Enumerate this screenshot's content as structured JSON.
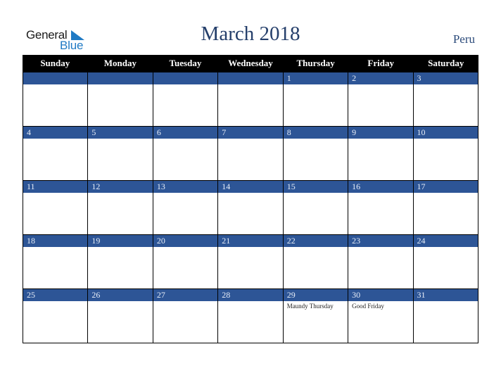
{
  "logo": {
    "line1": "General",
    "line2": "Blue",
    "icon": "triangle-flag-icon",
    "accent": "#1f7ac4"
  },
  "title": "March 2018",
  "country": "Peru",
  "colors": {
    "header_bg": "#000000",
    "day_bar": "#2d5596",
    "title": "#253f6b"
  },
  "weekdays": [
    "Sunday",
    "Monday",
    "Tuesday",
    "Wednesday",
    "Thursday",
    "Friday",
    "Saturday"
  ],
  "weeks": [
    [
      {
        "day": "",
        "event": ""
      },
      {
        "day": "",
        "event": ""
      },
      {
        "day": "",
        "event": ""
      },
      {
        "day": "",
        "event": ""
      },
      {
        "day": "1",
        "event": ""
      },
      {
        "day": "2",
        "event": ""
      },
      {
        "day": "3",
        "event": ""
      }
    ],
    [
      {
        "day": "4",
        "event": ""
      },
      {
        "day": "5",
        "event": ""
      },
      {
        "day": "6",
        "event": ""
      },
      {
        "day": "7",
        "event": ""
      },
      {
        "day": "8",
        "event": ""
      },
      {
        "day": "9",
        "event": ""
      },
      {
        "day": "10",
        "event": ""
      }
    ],
    [
      {
        "day": "11",
        "event": ""
      },
      {
        "day": "12",
        "event": ""
      },
      {
        "day": "13",
        "event": ""
      },
      {
        "day": "14",
        "event": ""
      },
      {
        "day": "15",
        "event": ""
      },
      {
        "day": "16",
        "event": ""
      },
      {
        "day": "17",
        "event": ""
      }
    ],
    [
      {
        "day": "18",
        "event": ""
      },
      {
        "day": "19",
        "event": ""
      },
      {
        "day": "20",
        "event": ""
      },
      {
        "day": "21",
        "event": ""
      },
      {
        "day": "22",
        "event": ""
      },
      {
        "day": "23",
        "event": ""
      },
      {
        "day": "24",
        "event": ""
      }
    ],
    [
      {
        "day": "25",
        "event": ""
      },
      {
        "day": "26",
        "event": ""
      },
      {
        "day": "27",
        "event": ""
      },
      {
        "day": "28",
        "event": ""
      },
      {
        "day": "29",
        "event": "Maundy Thursday"
      },
      {
        "day": "30",
        "event": "Good Friday"
      },
      {
        "day": "31",
        "event": ""
      }
    ]
  ]
}
